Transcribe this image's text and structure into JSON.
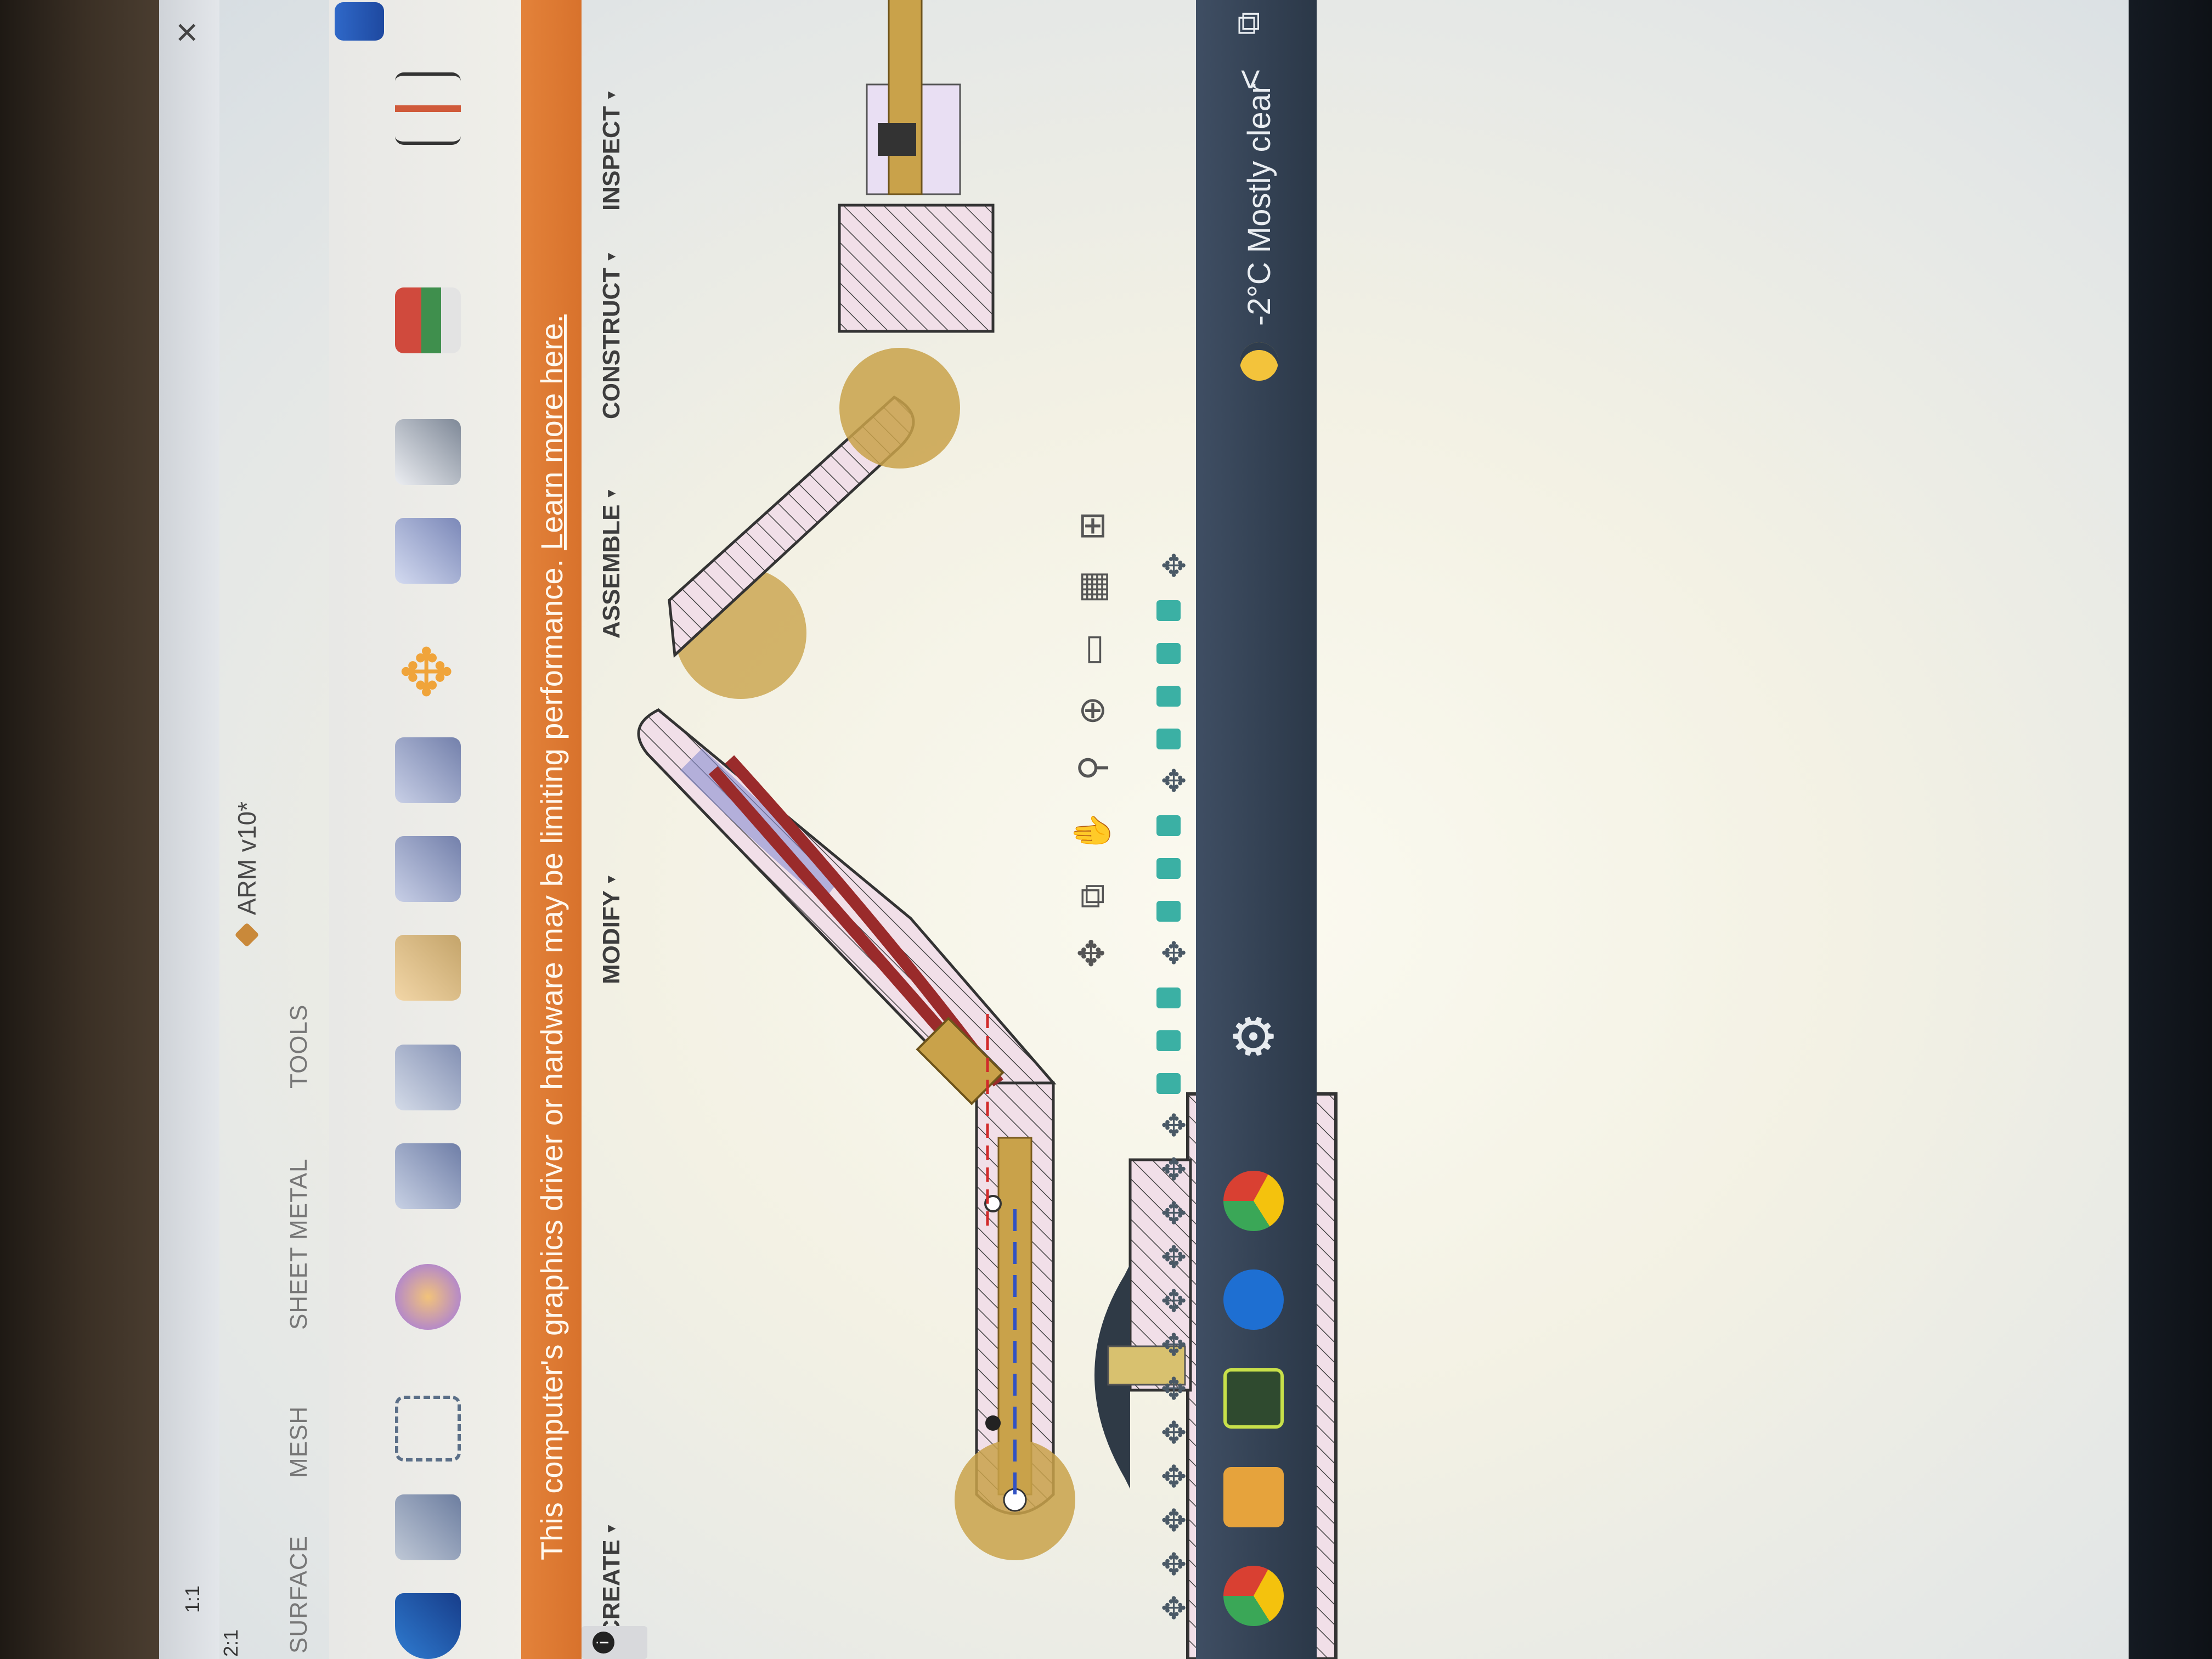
{
  "app": {
    "document_title": "ARM v10*",
    "close_label": "×"
  },
  "ribbon": {
    "tabs": [
      "SURFACE",
      "MESH",
      "SHEET METAL",
      "TOOLS"
    ],
    "groups": [
      {
        "label": "CREATE"
      },
      {
        "label": "MODIFY"
      },
      {
        "label": "ASSEMBLE"
      },
      {
        "label": "CONSTRUCT"
      },
      {
        "label": "INSPECT"
      }
    ]
  },
  "warning": {
    "message": "This computer's graphics driver or hardware may be limiting performance.",
    "link": "Learn more here."
  },
  "nav_toolbar": [
    "✥",
    "⧉",
    "✋",
    "⚲",
    "⊕",
    "▭",
    "▦",
    "⊞"
  ],
  "browser_panel": {
    "zoom_labels": [
      "1:1",
      "2:1"
    ]
  },
  "taskbar": {
    "weather": "-2°C  Mostly clear",
    "settings_icon": "⚙",
    "chevron": "<",
    "tray": "⧉"
  },
  "colors": {
    "warning_orange": "#da762f",
    "taskbar": "#334155",
    "section_fill": "#f1dfe8",
    "brass": "#c9a24a",
    "cable": "#9a2b2b",
    "timeline_feature": "#3bb0a4"
  }
}
